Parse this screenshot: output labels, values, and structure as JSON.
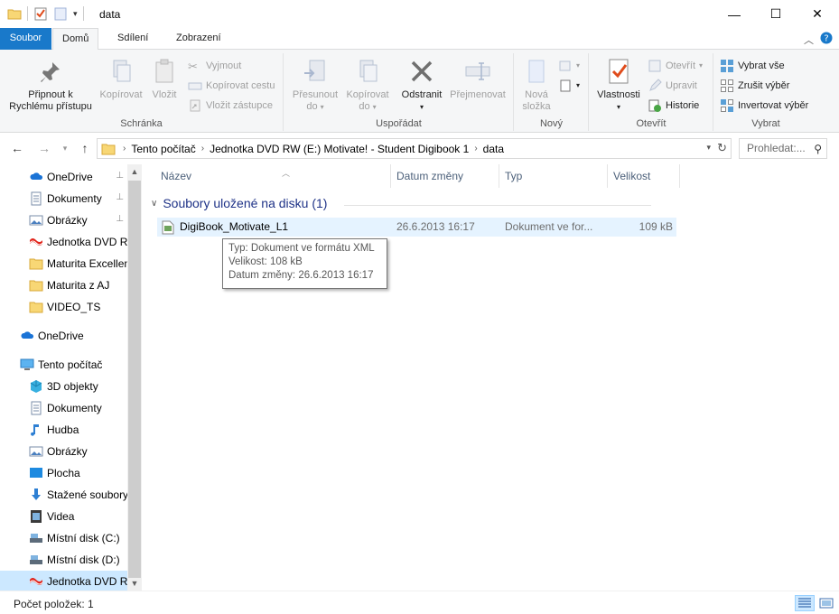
{
  "window": {
    "title": "data"
  },
  "ribbon_tabs": {
    "file": "Soubor",
    "home": "Domů",
    "share": "Sdílení",
    "view": "Zobrazení"
  },
  "ribbon": {
    "clipboard": {
      "label": "Schránka",
      "pin": "Připnout k Rychlému přístupu",
      "copy": "Kopírovat",
      "paste": "Vložit",
      "cut": "Vyjmout",
      "copy_path": "Kopírovat cestu",
      "paste_shortcut": "Vložit zástupce"
    },
    "organize": {
      "label": "Uspořádat",
      "move_to": "Přesunout do",
      "copy_to": "Kopírovat do",
      "delete": "Odstranit",
      "rename": "Přejmenovat"
    },
    "new": {
      "label": "Nový",
      "new_folder": "Nová složka"
    },
    "open": {
      "label": "Otevřít",
      "properties": "Vlastnosti",
      "open": "Otevřít",
      "edit": "Upravit",
      "history": "Historie"
    },
    "select": {
      "label": "Vybrat",
      "select_all": "Vybrat vše",
      "select_none": "Zrušit výběr",
      "invert": "Invertovat výběr"
    }
  },
  "address": {
    "crumbs": [
      "Tento počítač",
      "Jednotka DVD RW (E:) Motivate! - Student Digibook 1",
      "data"
    ]
  },
  "search": {
    "placeholder": "Prohledat:..."
  },
  "nav": {
    "items": [
      {
        "label": "OneDrive",
        "icon": "cloud-icon",
        "pinned": true
      },
      {
        "label": "Dokumenty",
        "icon": "documents-icon",
        "pinned": true
      },
      {
        "label": "Obrázky",
        "icon": "pictures-icon",
        "pinned": true
      },
      {
        "label": "Jednotka DVD RW",
        "icon": "dvd-icon"
      },
      {
        "label": "Maturita Excellent",
        "icon": "folder-icon"
      },
      {
        "label": "Maturita z AJ",
        "icon": "folder-icon"
      },
      {
        "label": "VIDEO_TS",
        "icon": "folder-icon"
      },
      {
        "label": "OneDrive",
        "icon": "cloud-icon"
      },
      {
        "label": "Tento počítač",
        "icon": "computer-icon"
      },
      {
        "label": "3D objekty",
        "icon": "3d-objects-icon"
      },
      {
        "label": "Dokumenty",
        "icon": "documents-icon"
      },
      {
        "label": "Hudba",
        "icon": "music-icon"
      },
      {
        "label": "Obrázky",
        "icon": "pictures-icon"
      },
      {
        "label": "Plocha",
        "icon": "desktop-icon"
      },
      {
        "label": "Stažené soubory",
        "icon": "downloads-icon"
      },
      {
        "label": "Videa",
        "icon": "videos-icon"
      },
      {
        "label": "Místní disk (C:)",
        "icon": "drive-icon"
      },
      {
        "label": "Místní disk (D:)",
        "icon": "drive-icon"
      },
      {
        "label": "Jednotka DVD RW",
        "icon": "dvd-icon"
      }
    ]
  },
  "columns": {
    "name": "Název",
    "date": "Datum změny",
    "type": "Typ",
    "size": "Velikost"
  },
  "group": {
    "title": "Soubory uložené na disku (1)"
  },
  "files": [
    {
      "name": "DigiBook_Motivate_L1",
      "date": "26.6.2013 16:17",
      "type": "Dokument ve for...",
      "size": "109 kB"
    }
  ],
  "tooltip": {
    "type": "Typ: Dokument ve formátu XML",
    "size": "Velikost: 108 kB",
    "date": "Datum změny: 26.6.2013 16:17"
  },
  "status": {
    "count": "Počet položek: 1"
  },
  "colors": {
    "accent": "#1979ca",
    "selection": "#cce8ff",
    "hover": "#e5f3ff",
    "group_header": "#1e3287"
  }
}
